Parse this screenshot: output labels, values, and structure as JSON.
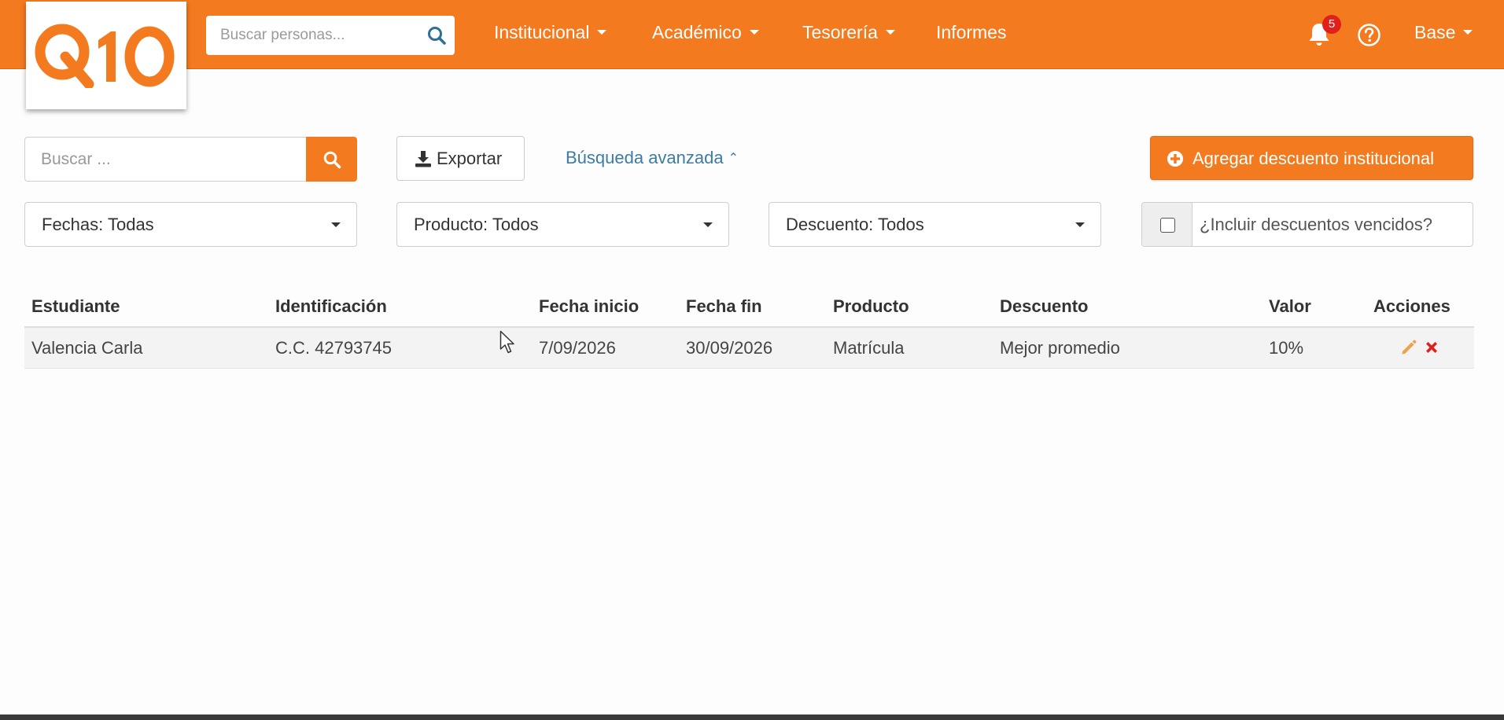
{
  "app": {
    "logo_text": "Q10",
    "brand_color": "#f47a1f"
  },
  "header": {
    "search_placeholder": "Buscar personas...",
    "nav": [
      {
        "label": "Institucional",
        "has_dropdown": true
      },
      {
        "label": "Académico",
        "has_dropdown": true
      },
      {
        "label": "Tesorería",
        "has_dropdown": true
      },
      {
        "label": "Informes",
        "has_dropdown": false
      }
    ],
    "notifications_count": "5",
    "user_menu_label": "Base",
    "icons": [
      "search-icon",
      "bell-icon",
      "help-circle-icon"
    ]
  },
  "toolbar": {
    "search_placeholder": "Buscar ...",
    "export_label": "Exportar",
    "advanced_search_label": "Búsqueda avanzada",
    "add_button_label": "Agregar descuento institucional"
  },
  "filters": {
    "dates_label": "Fechas: Todas",
    "product_label": "Producto: Todos",
    "discount_label": "Descuento: Todos",
    "include_expired_label": "¿Incluir descuentos vencidos?",
    "include_expired_checked": false
  },
  "table": {
    "columns": [
      "Estudiante",
      "Identificación",
      "Fecha inicio",
      "Fecha fin",
      "Producto",
      "Descuento",
      "Valor",
      "Acciones"
    ],
    "rows": [
      {
        "estudiante": "Valencia Carla",
        "identificacion": "C.C. 42793745",
        "fecha_inicio": "7/09/2026",
        "fecha_fin": "30/09/2026",
        "producto": "Matrícula",
        "descuento": "Mejor promedio",
        "valor": "10%",
        "actions": [
          "pencil-icon",
          "delete-x-icon"
        ]
      }
    ]
  }
}
